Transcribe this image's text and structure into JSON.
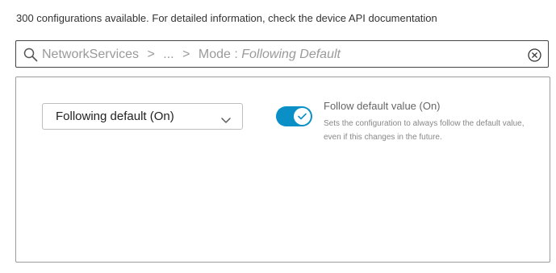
{
  "info": {
    "text": "300 configurations available. For detailed information, check the device API documentation"
  },
  "search": {
    "path_root": "NetworkServices",
    "separator": ">",
    "ellipsis": "...",
    "mode_label": "Mode :",
    "mode_value": "Following Default"
  },
  "setting": {
    "select_value": "Following default (On)",
    "toggle_on": true,
    "title": "Follow default value (On)",
    "description": "Sets the configuration to always follow the default value, even if this changes in the future."
  },
  "colors": {
    "toggle_on": "#0a8fc7",
    "border_dark": "#444444",
    "border_light": "#9c9c9c"
  },
  "icons": {
    "search": "search-icon",
    "clear": "clear-circle-icon",
    "chevron": "chevron-down-icon",
    "check": "check-icon"
  }
}
